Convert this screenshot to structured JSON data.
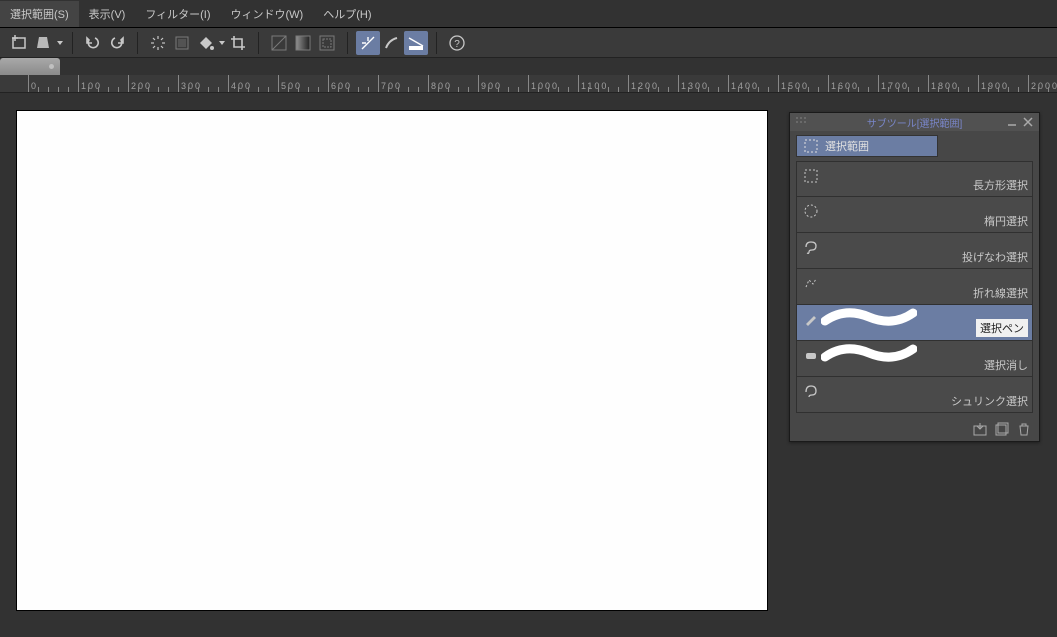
{
  "menu": {
    "items": [
      "選択範囲(S)",
      "表示(V)",
      "フィルター(I)",
      "ウィンドウ(W)",
      "ヘルプ(H)"
    ]
  },
  "toolbar": {
    "icons": [
      {
        "name": "new-canvas-icon",
        "interact": true
      },
      {
        "name": "fill-icon",
        "interact": true,
        "dropdown": true
      },
      {
        "name": "undo-icon",
        "interact": true
      },
      {
        "name": "redo-icon",
        "interact": true
      },
      {
        "name": "clear-icon",
        "interact": true
      },
      {
        "name": "layer-props-icon",
        "interact": true,
        "disabled": true
      },
      {
        "name": "bucket-icon",
        "interact": true,
        "dropdown": true
      },
      {
        "name": "crop-icon",
        "interact": true
      },
      {
        "name": "gradient-a-icon",
        "interact": true,
        "disabled": true
      },
      {
        "name": "gradient-b-icon",
        "interact": true,
        "disabled": true
      },
      {
        "name": "border-icon",
        "interact": true,
        "disabled": true
      },
      {
        "name": "snap-grid-icon",
        "interact": true,
        "active": true
      },
      {
        "name": "brush-snap-icon",
        "interact": true
      },
      {
        "name": "snap-ruler-icon",
        "interact": true,
        "active": true
      },
      {
        "name": "help-icon",
        "interact": true
      }
    ]
  },
  "ruler": {
    "marks": [
      "0",
      "100",
      "200",
      "300",
      "400",
      "500",
      "600",
      "700",
      "800",
      "900",
      "1000",
      "1100",
      "1200",
      "1300",
      "1400",
      "1500",
      "1600",
      "1700",
      "1800",
      "1900",
      "2000"
    ]
  },
  "panel": {
    "title": "サブツール[選択範囲]",
    "category": "選択範囲",
    "subtools": [
      {
        "label": "長方形選択",
        "icon": "rect-select-icon"
      },
      {
        "label": "楕円選択",
        "icon": "ellipse-select-icon"
      },
      {
        "label": "投げなわ選択",
        "icon": "lasso-select-icon"
      },
      {
        "label": "折れ線選択",
        "icon": "polyline-select-icon"
      },
      {
        "label": "選択ペン",
        "icon": "select-pen-icon",
        "highlighted": true,
        "stroke": true
      },
      {
        "label": "選択消し",
        "icon": "select-eraser-icon",
        "stroke": true
      },
      {
        "label": "シュリンク選択",
        "icon": "shrink-select-icon"
      }
    ],
    "footer_icons": [
      "import-subtool",
      "add-subtool",
      "delete-subtool"
    ]
  }
}
